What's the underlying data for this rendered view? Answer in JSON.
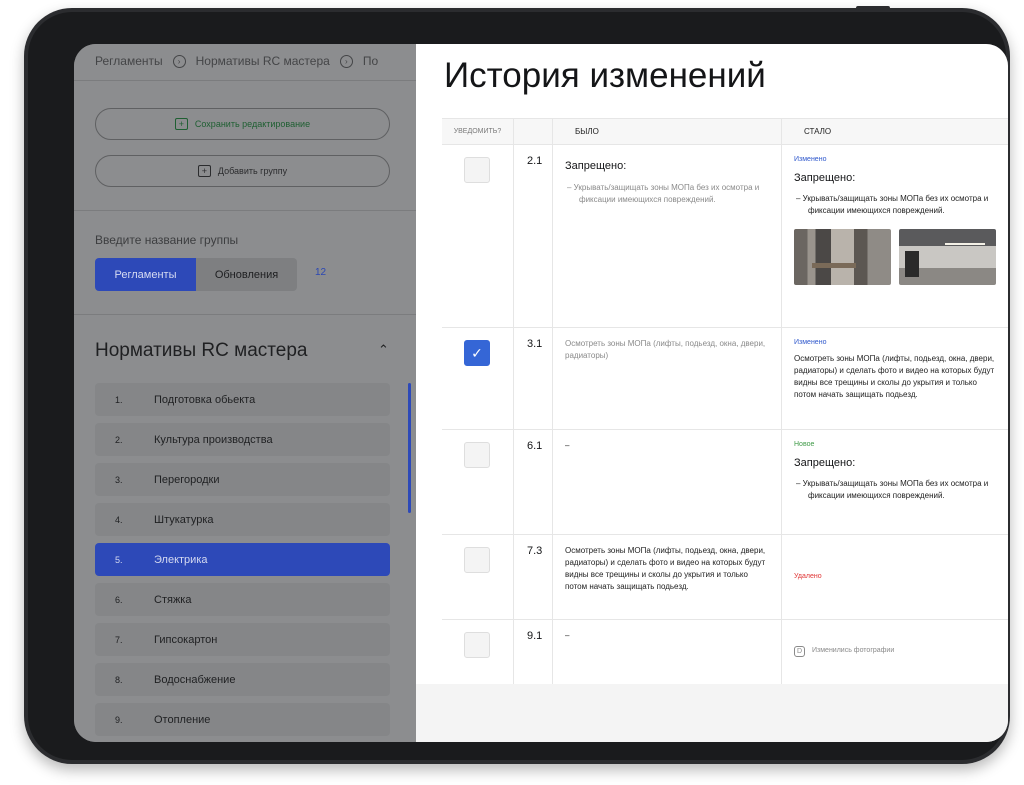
{
  "breadcrumbs": [
    "Регламенты",
    "Нормативы RC мастера",
    "По"
  ],
  "buttons": {
    "save": "Сохранить редактирование",
    "add_group": "Добавить группу"
  },
  "group_input": {
    "label": "Введите название группы"
  },
  "segment": {
    "active": "Регламенты",
    "inactive": "Обновления",
    "count": "12"
  },
  "section": {
    "title": "Нормативы RC мастера"
  },
  "list": [
    {
      "num": "1.",
      "label": "Подготовка обьекта"
    },
    {
      "num": "2.",
      "label": "Культура производства"
    },
    {
      "num": "3.",
      "label": "Перегородки"
    },
    {
      "num": "4.",
      "label": "Штукатурка"
    },
    {
      "num": "5.",
      "label": "Электрика"
    },
    {
      "num": "6.",
      "label": "Стяжка"
    },
    {
      "num": "7.",
      "label": "Гипсокартон"
    },
    {
      "num": "8.",
      "label": "Водоснабжение"
    },
    {
      "num": "9.",
      "label": "Отопление"
    }
  ],
  "modal": {
    "title": "История изменений",
    "headers": {
      "notify": "Уведомить?",
      "was": "Было",
      "became": "Стало"
    },
    "rows": [
      {
        "num": "2.1",
        "was_title": "Запрещено:",
        "was_bullet": "–  Укрывать/защищать зоны МОПа без их осмотра и фиксации имеющихся повреждений.",
        "tag": "Изменено",
        "became_title": "Запрещено:",
        "became_bullet": "–  Укрывать/защищать зоны МОПа без их осмотра и фиксации имеющихся повреждений."
      },
      {
        "num": "3.1",
        "was_text": "Осмотреть зоны МОПа (лифты, подьезд, окна, двери, радиаторы)",
        "tag": "Изменено",
        "became_text": "Осмотреть зоны МОПа (лифты, подьезд, окна, двери, радиаторы) и сделать фото и видео на которых будут видны все трещины и сколы до укрытия и только потом начать защищать подьезд."
      },
      {
        "num": "6.1",
        "was_text": "–",
        "tag": "Новое",
        "became_title": "Запрещено:",
        "became_bullet": "–  Укрывать/защищать зоны МОПа без их осмотра и фиксации имеющихся повреждений."
      },
      {
        "num": "7.3",
        "was_text": "Осмотреть зоны МОПа (лифты, подьезд, окна, двери, радиаторы) и сделать фото и видео на которых будут видны все трещины и сколы до укрытия и только потом начать защищать подьезд.",
        "tag": "Удалено"
      },
      {
        "num": "9.1",
        "was_text": "–",
        "note": "Изменились фотографии"
      }
    ]
  },
  "colors": {
    "accent": "#2d49b8",
    "checkbox": "#3566d6",
    "changed": "#2f58cc",
    "new": "#3f9a47",
    "deleted": "#e03535"
  }
}
